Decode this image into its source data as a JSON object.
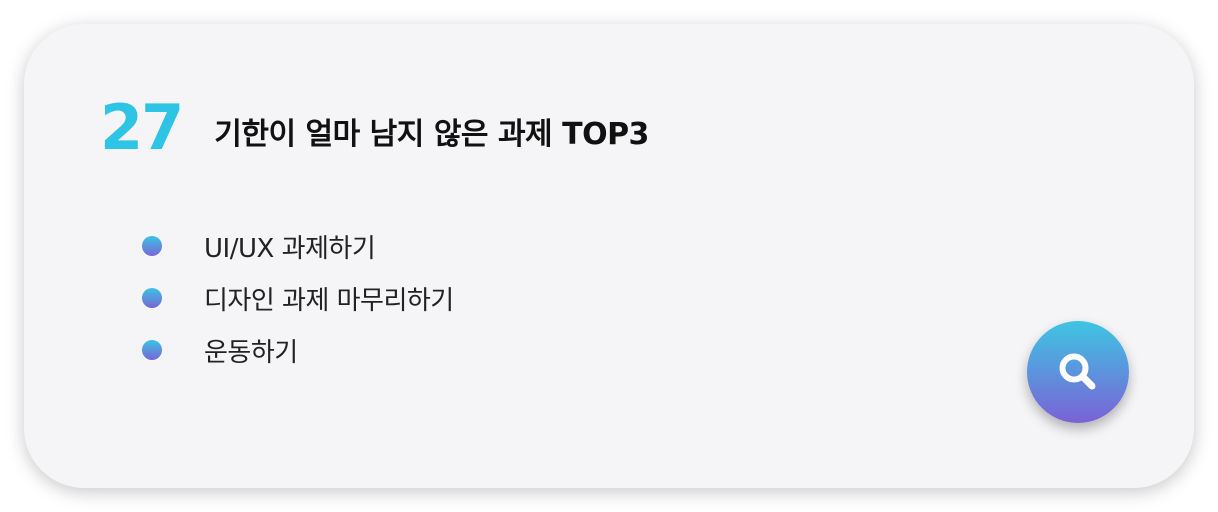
{
  "card": {
    "day_number": "27",
    "title": "기한이 얼마 남지 않은 과제 TOP3"
  },
  "tasks": [
    {
      "label": "UI/UX 과제하기"
    },
    {
      "label": "디자인 과제 마무리하기"
    },
    {
      "label": "운동하기"
    }
  ],
  "search_button": {
    "icon": "search-icon"
  },
  "colors": {
    "accent": "#2ec4e6",
    "gradient_start": "#3ec5e3",
    "gradient_end": "#7a62d6",
    "card_background": "#f5f5f7",
    "title_text": "#111111"
  }
}
